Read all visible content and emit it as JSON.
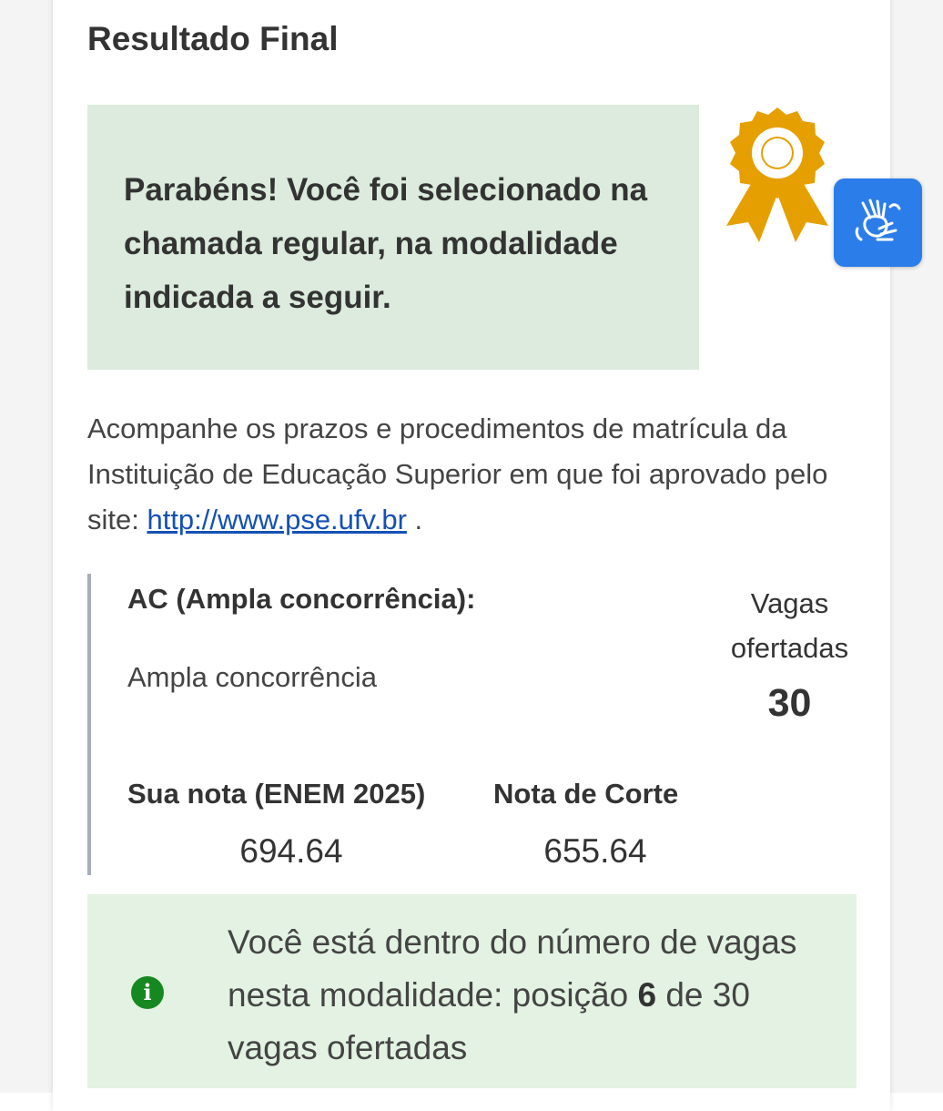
{
  "page": {
    "title": "Resultado Final"
  },
  "congrats": {
    "message": "Parabéns! Você foi selecionado na chamada regular, na modalidade indicada a seguir."
  },
  "icons": {
    "award": "award-ribbon-icon",
    "libras": "sign-language-icon",
    "status": "info-icon"
  },
  "colors": {
    "congrats_bg": "#dcebdd",
    "status_bg": "#e3f2e2",
    "award": "#e5a000",
    "libras_button": "#2b7de9",
    "link": "#1351b4",
    "info_icon": "#168821"
  },
  "info": {
    "text_before_link": "Acompanhe os prazos e procedimentos de matrícula da Instituição de Educação Superior em que foi aprovado pelo site: ",
    "link_text": "http://www.pse.ufv.br",
    "text_after_link": " ."
  },
  "modalidade": {
    "code": "AC (Ampla concorrência):",
    "description": "Ampla concorrência",
    "vagas_label": "Vagas ofertadas",
    "vagas_value": "30",
    "score_label": "Sua nota (ENEM 2025)",
    "score_value": "694.64",
    "cutoff_label": "Nota de Corte",
    "cutoff_value": "655.64"
  },
  "status": {
    "text_prefix": "Você está dentro do número de vagas nesta modalidade: posição ",
    "position": "6",
    "text_suffix": " de 30 vagas ofertadas"
  }
}
